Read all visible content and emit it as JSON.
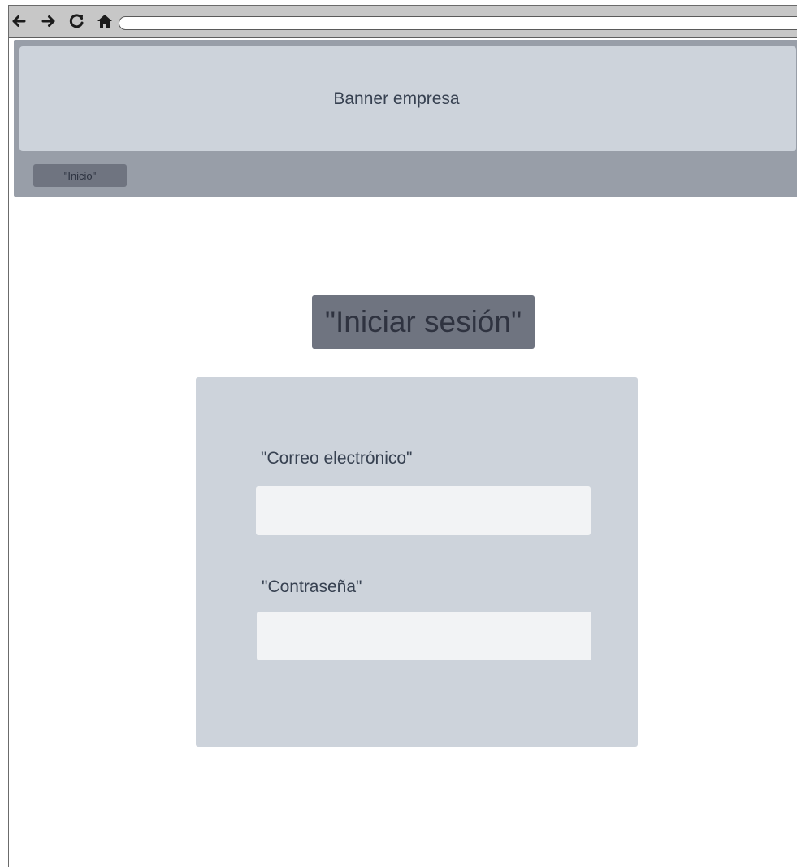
{
  "browser": {
    "icons": [
      "back-arrow-icon",
      "forward-arrow-icon",
      "reload-icon",
      "home-icon"
    ],
    "address": ""
  },
  "header": {
    "banner_text": "Banner empresa",
    "nav_items": [
      {
        "label": "\"Inicio\""
      }
    ]
  },
  "main": {
    "title": "\"Iniciar sesión\"",
    "form": {
      "email_label": "\"Correo electrónico\"",
      "email_value": "",
      "password_label": "\"Contraseña\"",
      "password_value": ""
    }
  },
  "colors": {
    "browser_bar": "#c7c7c7",
    "header_bg": "#989ea8",
    "banner_bg": "#cdd3db",
    "accent_dark": "#6f7480",
    "card_bg": "#cdd3db",
    "input_bg": "#f2f3f5",
    "text": "#374151"
  }
}
